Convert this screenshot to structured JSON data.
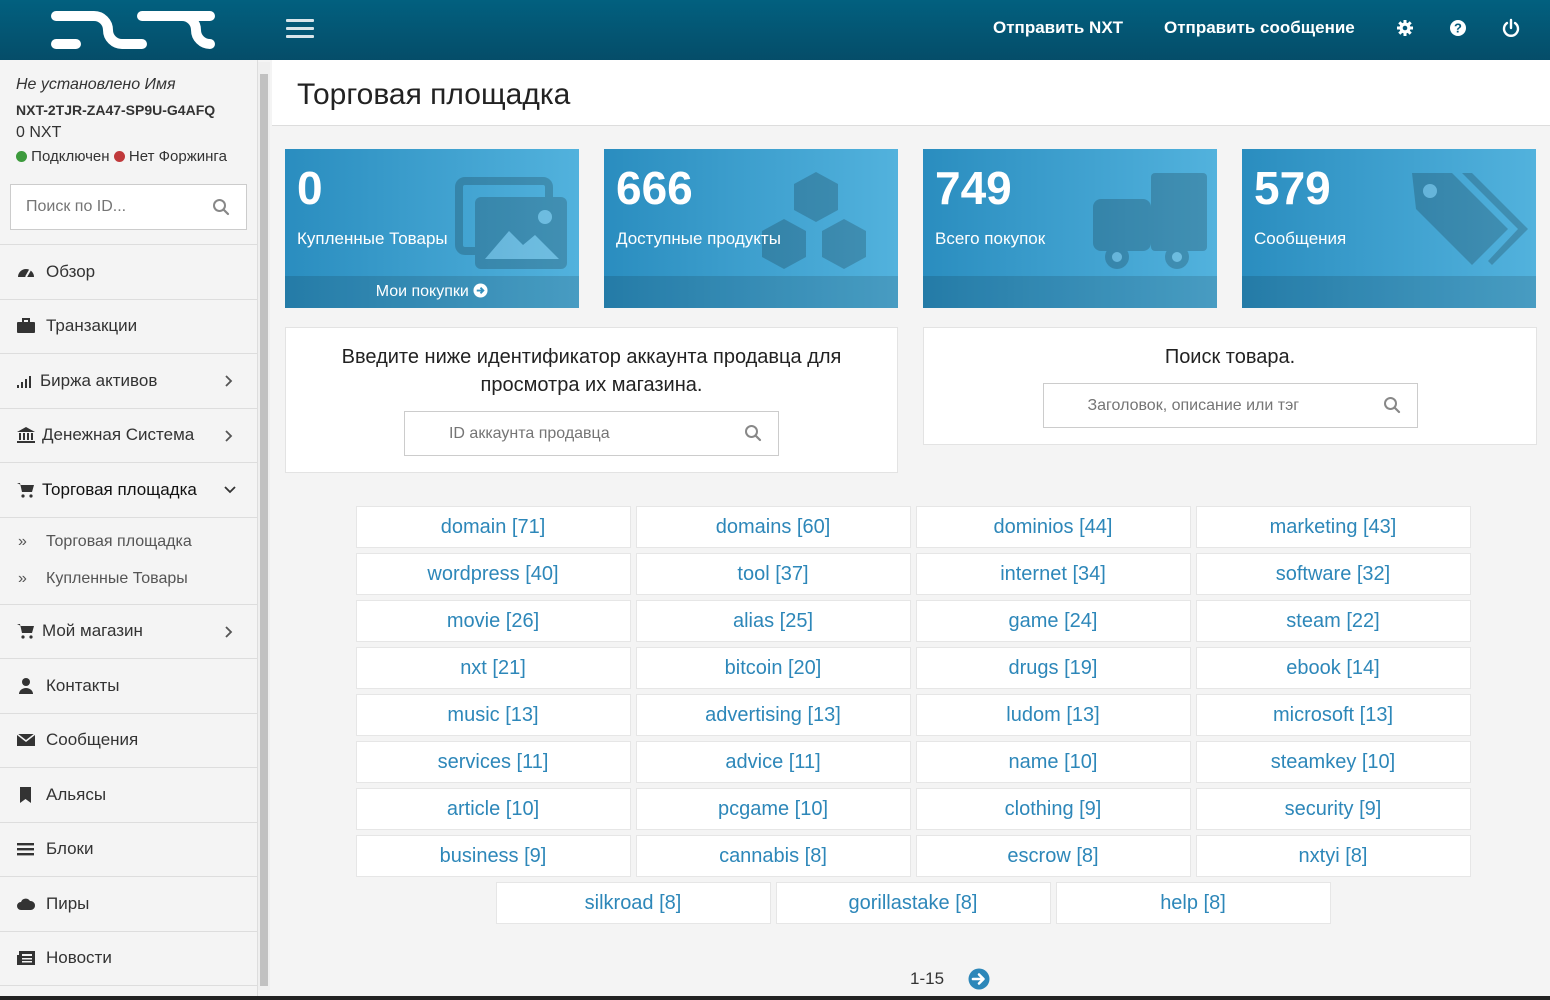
{
  "header": {
    "send_nxt": "Отправить NXT",
    "send_message": "Отправить сообщение"
  },
  "account": {
    "name": "Не установлено Имя",
    "id": "NXT-2TJR-ZA47-SP9U-G4AFQ",
    "balance": "0 NXT",
    "connected": "Подключен",
    "forging": "Нет Форжинга"
  },
  "sidebar_search": {
    "placeholder": "Поиск по ID..."
  },
  "nav": {
    "overview": "Обзор",
    "transactions": "Транзакции",
    "asset_exchange": "Биржа активов",
    "monetary_system": "Денежная Система",
    "marketplace": "Торговая площадка",
    "sub_marketplace": "Торговая площадка",
    "sub_purchased": "Купленные Товары",
    "my_store": "Мой магазин",
    "contacts": "Контакты",
    "messages": "Сообщения",
    "aliases": "Альясы",
    "blocks": "Блоки",
    "peers": "Пиры",
    "news": "Новости"
  },
  "page": {
    "title": "Торговая площадка"
  },
  "stats": [
    {
      "value": "0",
      "label": "Купленные Товары",
      "footer": "Мои покупки"
    },
    {
      "value": "666",
      "label": "Доступные продукты"
    },
    {
      "value": "749",
      "label": "Всего покупок"
    },
    {
      "value": "579",
      "label": "Сообщения"
    }
  ],
  "seller_panel": {
    "title_line1": "Введите ниже идентификатор аккаунта продавца для",
    "title_line2": "просмотра их магазина.",
    "placeholder": "ID аккаунта продавца"
  },
  "product_panel": {
    "title": "Поиск товара.",
    "placeholder": "Заголовок, описание или тэг"
  },
  "tags": [
    [
      "domain [71]",
      "domains [60]",
      "dominios [44]",
      "marketing [43]"
    ],
    [
      "wordpress [40]",
      "tool [37]",
      "internet [34]",
      "software [32]"
    ],
    [
      "movie [26]",
      "alias [25]",
      "game [24]",
      "steam [22]"
    ],
    [
      "nxt [21]",
      "bitcoin [20]",
      "drugs [19]",
      "ebook [14]"
    ],
    [
      "music [13]",
      "advertising [13]",
      "ludom [13]",
      "microsoft [13]"
    ],
    [
      "services [11]",
      "advice [11]",
      "name [10]",
      "steamkey [10]"
    ],
    [
      "article [10]",
      "pcgame [10]",
      "clothing [9]",
      "security [9]"
    ],
    [
      "business [9]",
      "cannabis [8]",
      "escrow [8]",
      "nxtyi [8]"
    ],
    [
      "silkroad [8]",
      "gorillastake [8]",
      "help [8]"
    ]
  ],
  "pager": {
    "range": "1-15"
  },
  "colors": {
    "header": "#02607f",
    "box": "#3a9fcf",
    "tag_link": "#2d87b9",
    "connected": "#3c9a3c",
    "not_forging": "#c0393b"
  }
}
